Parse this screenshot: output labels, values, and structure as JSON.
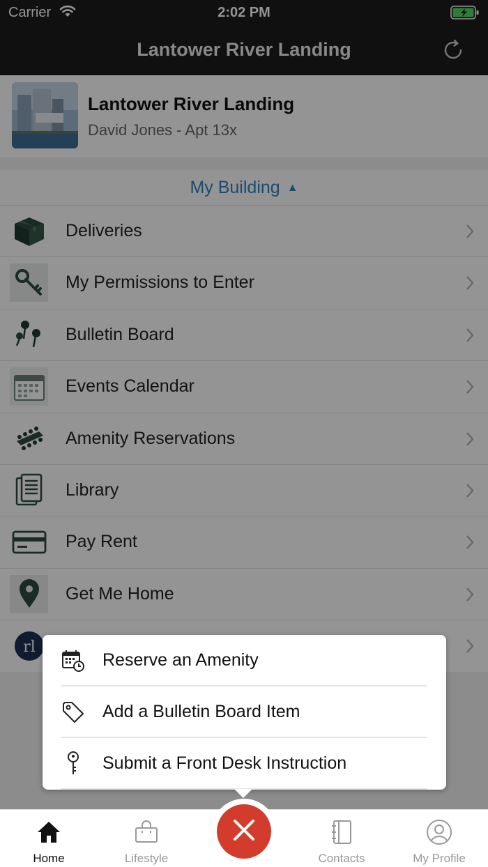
{
  "status_bar": {
    "carrier": "Carrier",
    "time": "2:02 PM"
  },
  "nav": {
    "title": "Lantower River Landing",
    "refresh_icon": "refresh-icon"
  },
  "property": {
    "name": "Lantower River Landing",
    "resident": "David Jones - Apt 13x"
  },
  "section": {
    "title": "My Building",
    "caret": "▲"
  },
  "menu": [
    {
      "label": "Deliveries",
      "icon": "box-icon"
    },
    {
      "label": "My Permissions to Enter",
      "icon": "key-icon"
    },
    {
      "label": "Bulletin Board",
      "icon": "pushpin-icon"
    },
    {
      "label": "Events Calendar",
      "icon": "calendar-icon"
    },
    {
      "label": "Amenity Reservations",
      "icon": "table-chairs-icon"
    },
    {
      "label": "Library",
      "icon": "documents-icon"
    },
    {
      "label": "Pay Rent",
      "icon": "credit-card-icon"
    },
    {
      "label": "Get Me Home",
      "icon": "map-pin-icon"
    },
    {
      "label": "",
      "icon": "rl-logo-icon"
    }
  ],
  "popover": {
    "items": [
      {
        "label": "Reserve an Amenity",
        "icon": "calendar-clock-icon"
      },
      {
        "label": "Add a Bulletin Board Item",
        "icon": "tag-icon"
      },
      {
        "label": "Submit a Front Desk Instruction",
        "icon": "key-icon"
      }
    ]
  },
  "tabs": [
    {
      "label": "Home",
      "icon": "home-icon",
      "active": true
    },
    {
      "label": "Lifestyle",
      "icon": "shopping-bag-icon",
      "active": false
    },
    {
      "label": "Contacts",
      "icon": "notebook-icon",
      "active": false
    },
    {
      "label": "My Profile",
      "icon": "user-circle-icon",
      "active": false
    }
  ],
  "fab": {
    "icon": "close-icon"
  },
  "colors": {
    "accent_blue": "#2e83c2",
    "fab_red": "#d33c2c",
    "battery_green": "#4cd964"
  }
}
